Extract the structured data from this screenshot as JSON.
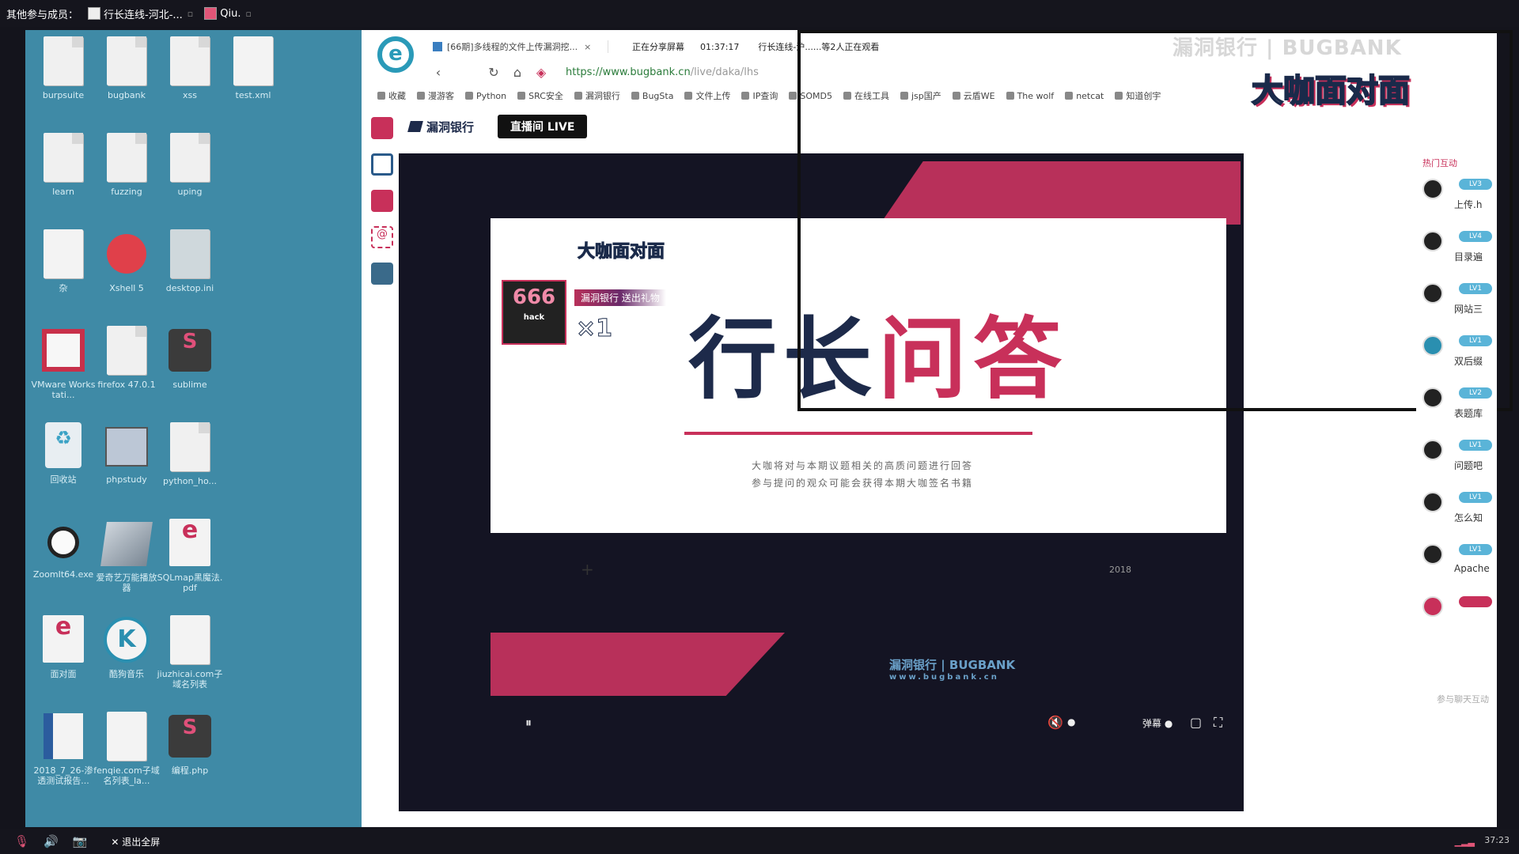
{
  "topbar": {
    "others_label": "其他参与成员：",
    "participants": [
      {
        "name": "行长连线-河北-..."
      },
      {
        "name": "Qiu."
      }
    ]
  },
  "desktop": {
    "icons": [
      {
        "label": "burpsuite"
      },
      {
        "label": "bugbank"
      },
      {
        "label": "xss"
      },
      {
        "label": "test.xml"
      },
      {
        "label": "learn"
      },
      {
        "label": "fuzzing"
      },
      {
        "label": "uping"
      },
      {
        "label": "杂"
      },
      {
        "label": "Xshell 5"
      },
      {
        "label": "desktop.ini"
      },
      {
        "label": "VMware Workstati..."
      },
      {
        "label": "firefox 47.0.1"
      },
      {
        "label": "sublime"
      },
      {
        "label": "回收站"
      },
      {
        "label": "phpstudy"
      },
      {
        "label": "python_ho..."
      },
      {
        "label": "ZoomIt64.exe"
      },
      {
        "label": "爱奇艺万能播放器"
      },
      {
        "label": "SQLmap黑魔法.pdf"
      },
      {
        "label": "面对面"
      },
      {
        "label": "酷狗音乐"
      },
      {
        "label": "jiuzhicai.com子域名列表"
      },
      {
        "label": "2018_7_26-渗透测试报告..."
      },
      {
        "label": "fenqie.com子域名列表_la..."
      },
      {
        "label": "编程.php"
      }
    ],
    "add_label": "+"
  },
  "browser": {
    "tab_title": "[66期]多线程的文件上传漏洞挖...",
    "share_status": "正在分享屏幕",
    "share_time": "01:37:17",
    "viewers": "行长连线-沪......等2人正在观看",
    "url_main": "https://www.bugbank.cn",
    "url_rest": "/live/daka/lhs",
    "bookmarks": [
      "收藏",
      "漫游客",
      "Python",
      "SRC安全",
      "漏洞银行",
      "BugSta",
      "文件上传",
      "IP查询",
      "SOMD5",
      "在线工具",
      "jsp国产",
      "云盾WE",
      "The wolf",
      "netcat",
      "知道创宇"
    ]
  },
  "watermark_top": {
    "line1": "漏洞银行 | BUGBANK",
    "line2": "大咖面对面"
  },
  "site": {
    "brand": "漏洞银行",
    "live_button": "直播间 LIVE"
  },
  "slide": {
    "logo": "大咖面对面",
    "title_part1": "行长",
    "title_part2": "问答",
    "line1": "大咖将对与本期议题相关的高质问题进行回答",
    "line2": "参与提问的观众可能会获得本期大咖签名书籍",
    "year": "2018",
    "plus": "+"
  },
  "gift": {
    "image_text": "666",
    "image_sub": "hack",
    "from_text": "漏洞银行 送出礼物",
    "count": "×1"
  },
  "video_footer_logo": {
    "name": "漏洞银行 | BUGBANK",
    "url": "www.bugbank.cn"
  },
  "controls": {
    "pause": "⏸",
    "mute": "🔇",
    "danmaku": "弹幕",
    "pip": "▢",
    "fullscreen": "⛶"
  },
  "chat": {
    "title": "热门互动",
    "messages": [
      {
        "level": "LV3",
        "text": "上传.h"
      },
      {
        "level": "LV4",
        "text": "目录遍"
      },
      {
        "level": "LV1",
        "text": "网站三"
      },
      {
        "level": "LV1",
        "text": "双后缀"
      },
      {
        "level": "LV2",
        "text": "表题库"
      },
      {
        "level": "LV1",
        "text": "问题吧"
      },
      {
        "level": "LV1",
        "text": "怎么知"
      },
      {
        "level": "LV1",
        "text": "Apache"
      },
      {
        "level": "",
        "text": ""
      }
    ],
    "more": "参与聊天互动"
  },
  "watermark_br": {
    "name": "漏洞银行",
    "url": "BUGBANK.CN"
  },
  "bottombar": {
    "exit_fullscreen": "退出全屏",
    "clock": "37:23"
  }
}
